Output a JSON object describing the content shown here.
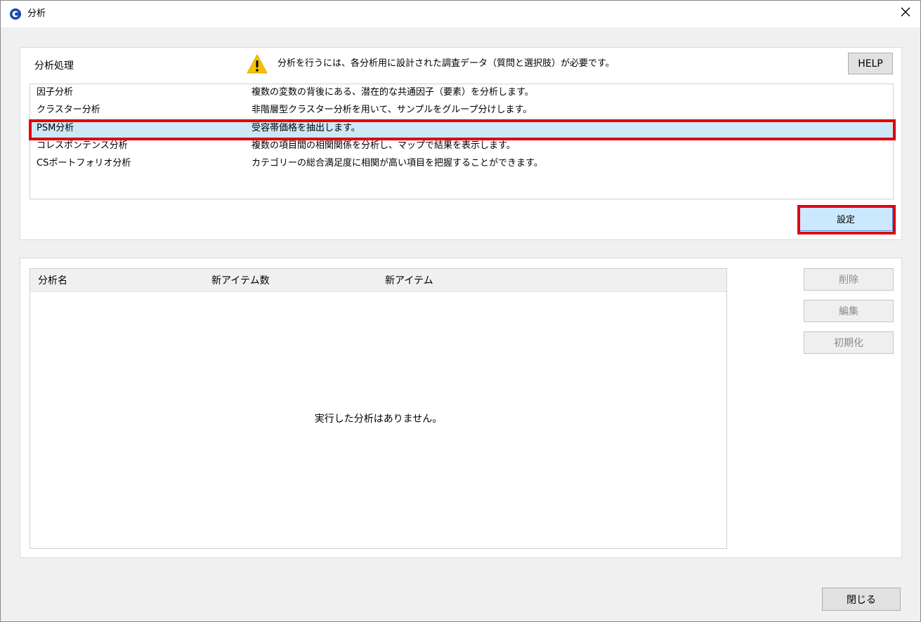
{
  "window": {
    "title": "分析"
  },
  "top_panel": {
    "section_label": "分析処理",
    "warning_text": "分析を行うには、各分析用に設計された調査データ（質問と選択肢）が必要です。",
    "help_label": "HELP",
    "analyses": [
      {
        "name": "因子分析",
        "description": "複数の変数の背後にある、潜在的な共通因子（要素）を分析します。"
      },
      {
        "name": "クラスター分析",
        "description": "非階層型クラスター分析を用いて、サンプルをグループ分けします。"
      },
      {
        "name": "PSM分析",
        "description": "受容帯価格を抽出します。",
        "selected": true
      },
      {
        "name": "コレスポンテンス分析",
        "description": "複数の項目間の相関関係を分析し、マップで結果を表示します。"
      },
      {
        "name": "CSポートフォリオ分析",
        "description": "カテゴリーの総合満足度に相関が高い項目を把握することができます。"
      }
    ],
    "settings_label": "設定"
  },
  "bottom_panel": {
    "columns": [
      "分析名",
      "新アイテム数",
      "新アイテム"
    ],
    "empty_message": "実行した分析はありません。",
    "delete_label": "削除",
    "edit_label": "編集",
    "reset_label": "初期化"
  },
  "footer": {
    "close_label": "閉じる"
  },
  "colors": {
    "selection": "#cde8f7",
    "highlight": "#e0000f",
    "accent": "#cce8ff",
    "warning": "#f5c200",
    "app_icon": "#1a4aa8"
  }
}
